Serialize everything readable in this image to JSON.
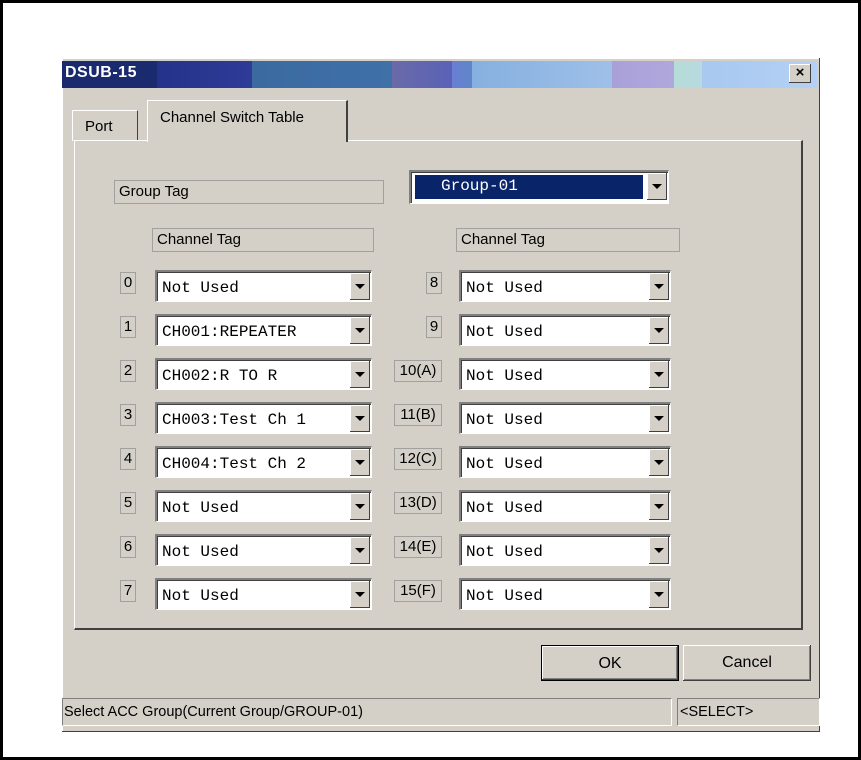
{
  "window": {
    "title": "DSUB-15",
    "close_glyph": "×"
  },
  "tabs": [
    {
      "label": "Port",
      "active": false
    },
    {
      "label": "Channel Switch Table",
      "active": true
    }
  ],
  "group": {
    "label": "Group Tag",
    "value": "Group-01"
  },
  "column_headers": {
    "left": "Channel Tag",
    "right": "Channel Tag"
  },
  "channels_left": [
    {
      "index": "0",
      "value": "Not Used"
    },
    {
      "index": "1",
      "value": "CH001:REPEATER"
    },
    {
      "index": "2",
      "value": "CH002:R TO R"
    },
    {
      "index": "3",
      "value": "CH003:Test Ch 1"
    },
    {
      "index": "4",
      "value": "CH004:Test Ch 2"
    },
    {
      "index": "5",
      "value": "Not Used"
    },
    {
      "index": "6",
      "value": "Not Used"
    },
    {
      "index": "7",
      "value": "Not Used"
    }
  ],
  "channels_right": [
    {
      "index": "8",
      "value": "Not Used"
    },
    {
      "index": "9",
      "value": "Not Used"
    },
    {
      "index": "10(A)",
      "value": "Not Used"
    },
    {
      "index": "11(B)",
      "value": "Not Used"
    },
    {
      "index": "12(C)",
      "value": "Not Used"
    },
    {
      "index": "13(D)",
      "value": "Not Used"
    },
    {
      "index": "14(E)",
      "value": "Not Used"
    },
    {
      "index": "15(F)",
      "value": "Not Used"
    }
  ],
  "buttons": {
    "ok": "OK",
    "cancel": "Cancel"
  },
  "status": {
    "message": "Select ACC Group(Current Group/GROUP-01)",
    "mode": "<SELECT>"
  },
  "colors": {
    "face": "#d4d0c8",
    "selection": "#0a246a"
  },
  "icons": [
    "close-icon",
    "dropdown-arrow-icon"
  ]
}
